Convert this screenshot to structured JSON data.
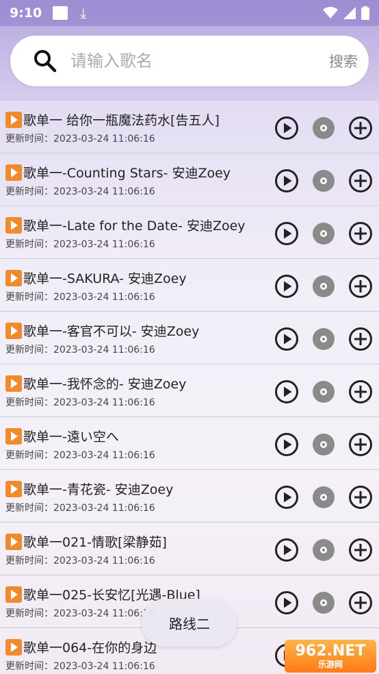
{
  "status_bar": {
    "time": "9:10"
  },
  "search": {
    "placeholder": "请输入歌名",
    "button_label": "搜索"
  },
  "list": {
    "items": [
      {
        "title": "歌单一 给你一瓶魔法药水[告五人]",
        "time": "更新时间：2023-03-24 11:06:16"
      },
      {
        "title": "歌单一-Counting Stars- 安迪Zoey",
        "time": "更新时间：2023-03-24 11:06:16"
      },
      {
        "title": "歌单一-Late for the Date- 安迪Zoey",
        "time": "更新时间：2023-03-24 11:06:16"
      },
      {
        "title": "歌单一-SAKURA- 安迪Zoey",
        "time": "更新时间：2023-03-24 11:06:16"
      },
      {
        "title": "歌单一-客官不可以- 安迪Zoey",
        "time": "更新时间：2023-03-24 11:06:16"
      },
      {
        "title": "歌单一-我怀念的- 安迪Zoey",
        "time": "更新时间：2023-03-24 11:06:16"
      },
      {
        "title": "歌单一-遠い空へ",
        "time": "更新时间：2023-03-24 11:06:16"
      },
      {
        "title": "歌单一-青花瓷- 安迪Zoey",
        "time": "更新时间：2023-03-24 11:06:16"
      },
      {
        "title": "歌单一021-情歌[梁静茹]",
        "time": "更新时间：2023-03-24 11:06:16"
      },
      {
        "title": "歌单一025-长安忆[光遇-Blue]",
        "time": "更新时间：2023-03-24 11:06:16"
      },
      {
        "title": "歌单一064-在你的身边",
        "time": "更新时间：2023-03-24 11:06:16"
      }
    ]
  },
  "toast": {
    "text": "路线二"
  },
  "watermark": {
    "big": "962.NET",
    "small": "乐游网"
  },
  "colors": {
    "accent": "#f08a2c",
    "icon": "#222222",
    "disc": "#8a8a8a"
  }
}
